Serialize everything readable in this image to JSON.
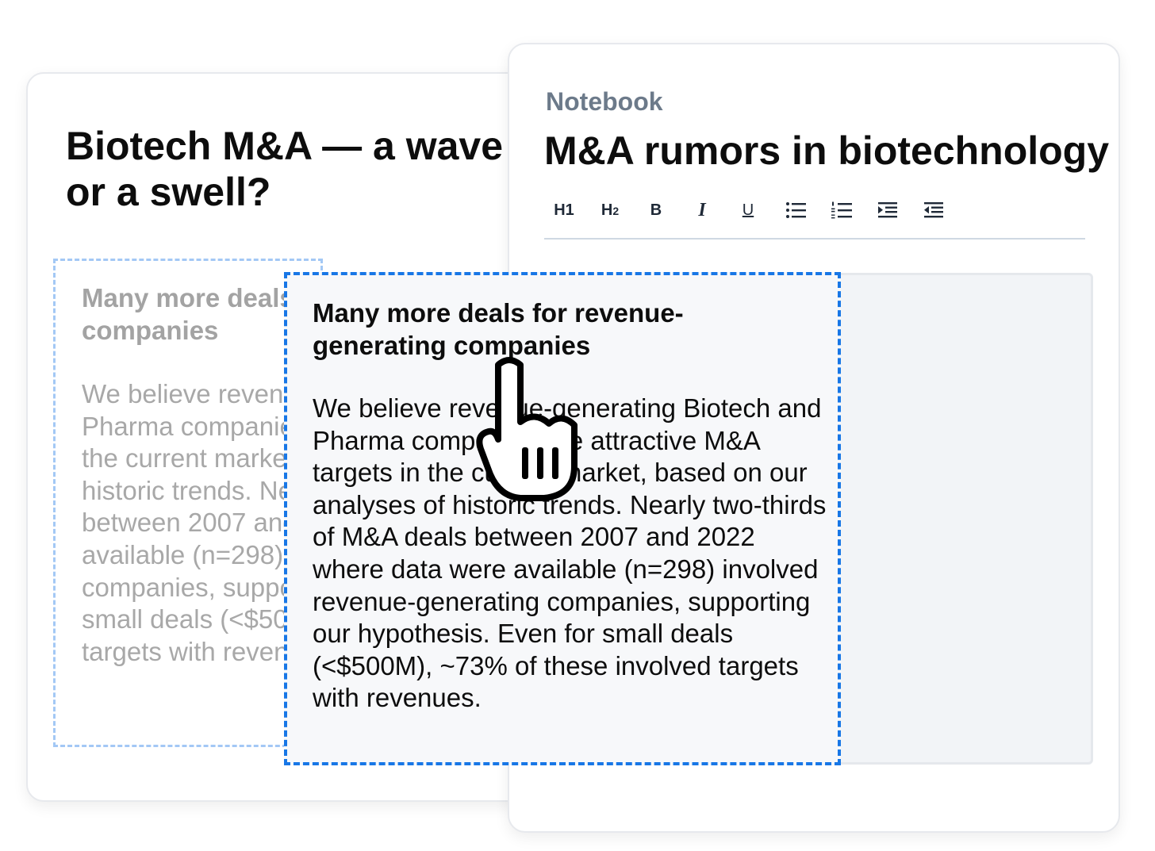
{
  "source_doc": {
    "title": "Biotech M&A — a wave or a swell?",
    "selected_heading": "Many more deals for revenue-generating companies",
    "selected_body": "We believe revenue-generating Biotech and Pharma companies are attractive M&A targets in the current market, based on our analyses of historic trends. Nearly two-thirds of M&A deals between 2007 and 2022 where data were available (n=298) involved revenue-generating companies, supporting our hypothesis. Even for small deals (<$500M), ~73% of these involved targets with revenues."
  },
  "notebook": {
    "label": "Notebook",
    "title": "M&A rumors in biotechnology",
    "toolbar": {
      "h1": "H1",
      "h2_letter": "H",
      "h2_number": "2",
      "bold": "B",
      "italic": "I",
      "underline": "U"
    }
  },
  "dragged_clip": {
    "heading": "Many more deals for revenue-generating companies",
    "body": "We believe revenue-generating Biotech and Pharma companies are attractive M&A targets in the current market, based on our analyses of historic trends. Nearly two-thirds of M&A deals between 2007 and 2022 where data were available (n=298) involved revenue-generating companies, supporting our hypothesis. Even for small deals (<$500M), ~73% of these involved targets with revenues."
  },
  "cursor": {
    "icon": "grab-hand-icon"
  },
  "colors": {
    "selection_border": "#1877e6",
    "ghost_selection_border": "#a3c8f5",
    "notebook_label": "#6c7a8a"
  }
}
